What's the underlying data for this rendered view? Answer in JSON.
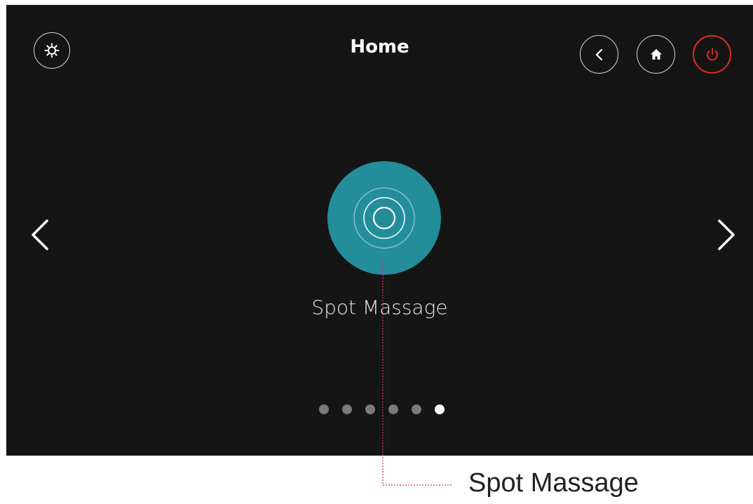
{
  "header": {
    "title": "Home",
    "settings_icon": "gear-icon",
    "back_icon": "chevron-left-icon",
    "home_icon": "home-icon",
    "power_icon": "power-icon"
  },
  "carousel": {
    "prev_icon": "chevron-left-icon",
    "next_icon": "chevron-right-icon",
    "current_item": {
      "label": "Spot Massage",
      "icon": "concentric-circles-icon"
    },
    "page_count": 6,
    "active_page": 6
  },
  "annotation": {
    "label": "Spot Massage"
  },
  "colors": {
    "background": "#151515",
    "accent": "#238e9a",
    "power": "#e02a2a",
    "annotation_line": "#d6336c"
  }
}
